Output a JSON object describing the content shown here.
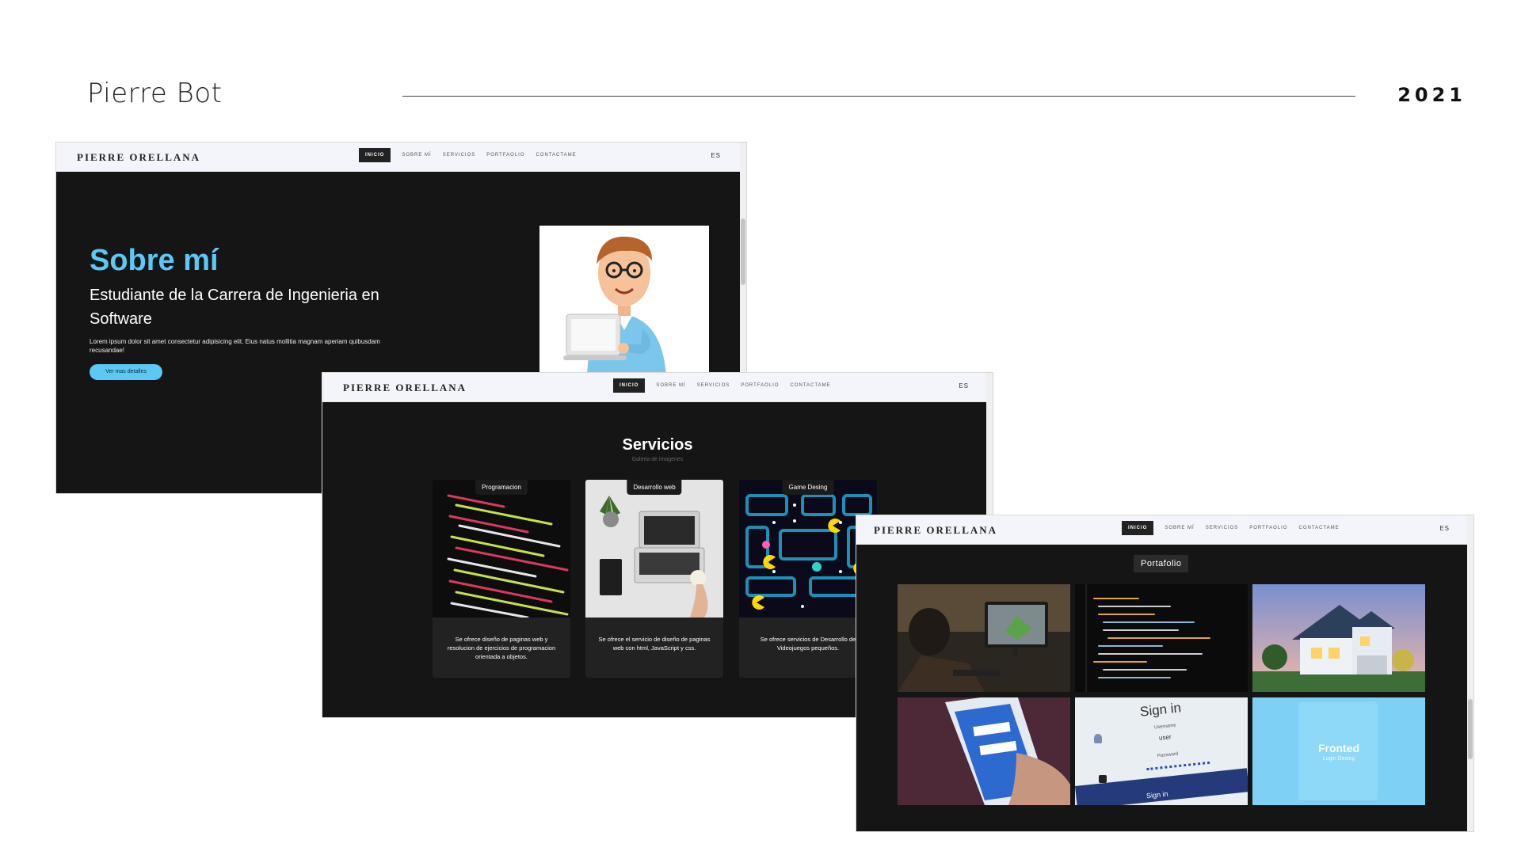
{
  "slide": {
    "title": "Pierre Bot",
    "year": "2021"
  },
  "site": {
    "brand": "PIERRE ORELLANA",
    "nav": [
      "INICIO",
      "SOBRE MÍ",
      "SERVICIOS",
      "PORTFAOLIO",
      "CONTACTAME"
    ],
    "active_nav": "INICIO",
    "lang": "ES"
  },
  "about": {
    "heading": "Sobre mí",
    "subtitle": "Estudiante de la Carrera de Ingenieria en Software",
    "body": "Lorem ipsum dolor sit amet consectetur adipisicing elit. Eius natus mollitia magnam aperiam quibusdam recusandae!",
    "button": "Ver mas detalles"
  },
  "services": {
    "heading": "Servicios",
    "subheading": "Galeria de imagenes",
    "cards": [
      {
        "tag": "Programacion",
        "text": "Se ofrece diseño de paginas web y resolucion de ejercicios de programacion orientada a objetos."
      },
      {
        "tag": "Desarrollo web",
        "text": "Se ofrece el servicio de diseño de paginas web con html, JavaScript y css."
      },
      {
        "tag": "Game Desing",
        "text": "Se ofrece servicios de Desarrollo de Videojuegos pequeños."
      }
    ]
  },
  "portfolio": {
    "heading": "Portafolio",
    "tiles": [
      {
        "title": ""
      },
      {
        "title": ""
      },
      {
        "title": ""
      },
      {
        "title": ""
      },
      {
        "title": "Sign in",
        "username_label": "Username",
        "username_value": "user",
        "password_label": "Password",
        "button": "Sign in"
      },
      {
        "title": "Fronted",
        "subtitle": "Login Desing"
      }
    ]
  },
  "colors": {
    "accent": "#5bc8f5",
    "dark_bg": "#151515",
    "nav_bg": "#f3f5fa"
  }
}
